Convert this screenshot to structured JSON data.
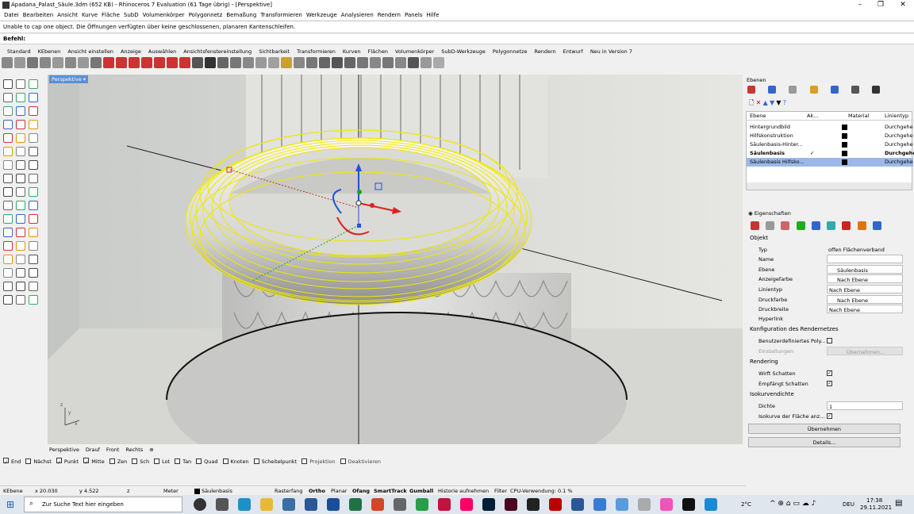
{
  "window": {
    "title": "Apadana_Palast_Säule.3dm (652 KB) - Rhinoceros 7 Evaluation (61 Tage übrig) - [Perspektive]"
  },
  "menu": [
    "Datei",
    "Bearbeiten",
    "Ansicht",
    "Kurve",
    "Fläche",
    "SubD",
    "Volumenkörper",
    "Polygonnetz",
    "Bemaßung",
    "Transformieren",
    "Werkzeuge",
    "Analysieren",
    "Rendern",
    "Panels",
    "Hilfe"
  ],
  "command": {
    "history": "Unable to cap one object. Die Öffnungen verfügten über keine geschlossenen, planaren Kantenschleifen.",
    "prompt": "Befehl:"
  },
  "toolbar_tabs": [
    "Standard",
    "KEbenen",
    "Ansicht einstellen",
    "Anzeige",
    "Auswählen",
    "Ansichtsfenstereinstellung",
    "Sichtbarkeit",
    "Transformieren",
    "Kurven",
    "Flächen",
    "Volumenkörper",
    "SubD-Werkzeuge",
    "Polygonnetze",
    "Rendern",
    "Entwurf",
    "Neu in Version 7"
  ],
  "viewport": {
    "active": "Perspektive",
    "tabs": [
      "Perspektive",
      "Drauf",
      "Front",
      "Rechts"
    ],
    "add": "⊕"
  },
  "osnaps": [
    {
      "label": "End",
      "checked": true
    },
    {
      "label": "Nächst",
      "checked": false
    },
    {
      "label": "Punkt",
      "checked": true
    },
    {
      "label": "Mitte",
      "checked": true
    },
    {
      "label": "Zen",
      "checked": false
    },
    {
      "label": "Sch",
      "checked": false
    },
    {
      "label": "Lot",
      "checked": false
    },
    {
      "label": "Tan",
      "checked": false
    },
    {
      "label": "Quad",
      "checked": false
    },
    {
      "label": "Knoten",
      "checked": false
    },
    {
      "label": "Scheitelpunkt",
      "checked": false
    },
    {
      "label": "Projektion",
      "checked": false
    },
    {
      "label": "Deaktivieren",
      "checked": false
    }
  ],
  "status": {
    "plane": "KEbene",
    "x": "x 20.030",
    "y": "y 4.522",
    "z": "z",
    "unit": "Meter",
    "layer": "Säulenbasis",
    "items": [
      "Rasterfang",
      "Ortho",
      "Planar",
      "Ofang",
      "SmartTrack",
      "Gumball",
      "Historie aufnehmen",
      "Filter",
      "CPU-Verwendung: 0.1 %"
    ]
  },
  "layers_panel": {
    "title": "Ebenen",
    "columns": [
      "Ebene",
      "Ak...",
      "Material",
      "Linientyp"
    ],
    "rows": [
      {
        "name": "Hintergrundbild",
        "linetype": "Durchgehe"
      },
      {
        "name": "Hilfskonstruktion",
        "linetype": "Durchgehe"
      },
      {
        "name": "Säulenbasis-Hinter...",
        "linetype": "Durchgehe"
      },
      {
        "name": "Säulenbasis",
        "linetype": "Durchgehe",
        "current": "✓"
      },
      {
        "name": "Säulenbasis Hilfsko...",
        "linetype": "Durchgehe"
      }
    ]
  },
  "properties": {
    "title": "Eigenschaften",
    "section": "Objekt",
    "rows": [
      {
        "k": "Typ",
        "v": "offen Flächenverband"
      },
      {
        "k": "Name",
        "v": ""
      },
      {
        "k": "Ebene",
        "v": "Säulenbasis"
      },
      {
        "k": "Anzeigefarbe",
        "v": "Nach Ebene"
      },
      {
        "k": "Linientyp",
        "v": "Nach Ebene"
      },
      {
        "k": "Druckfarbe",
        "v": "Nach Ebene"
      },
      {
        "k": "Druckbreite",
        "v": "Nach Ebene"
      },
      {
        "k": "Hyperlink",
        "v": ""
      }
    ],
    "render_mesh": "Konfiguration des Rendernetzes",
    "custom_poly": "Benutzerdefiniertes Poly...",
    "settings": "Einstellungen",
    "apply_small": "Übernehmen...",
    "rendering": "Rendering",
    "cast": "Wirft Schatten",
    "receive": "Empfängt Schatten",
    "iso": "Isokurvendichte",
    "density_label": "Dichte",
    "density": "1",
    "iso_show": "Isokurve der Fläche anz...",
    "apply": "Übernehmen",
    "details": "Details..."
  },
  "taskbar": {
    "search": "Zur Suche Text hier eingeben",
    "temp": "2°C",
    "lang": "DEU",
    "time": "17:38",
    "date": "29.11.2021"
  }
}
